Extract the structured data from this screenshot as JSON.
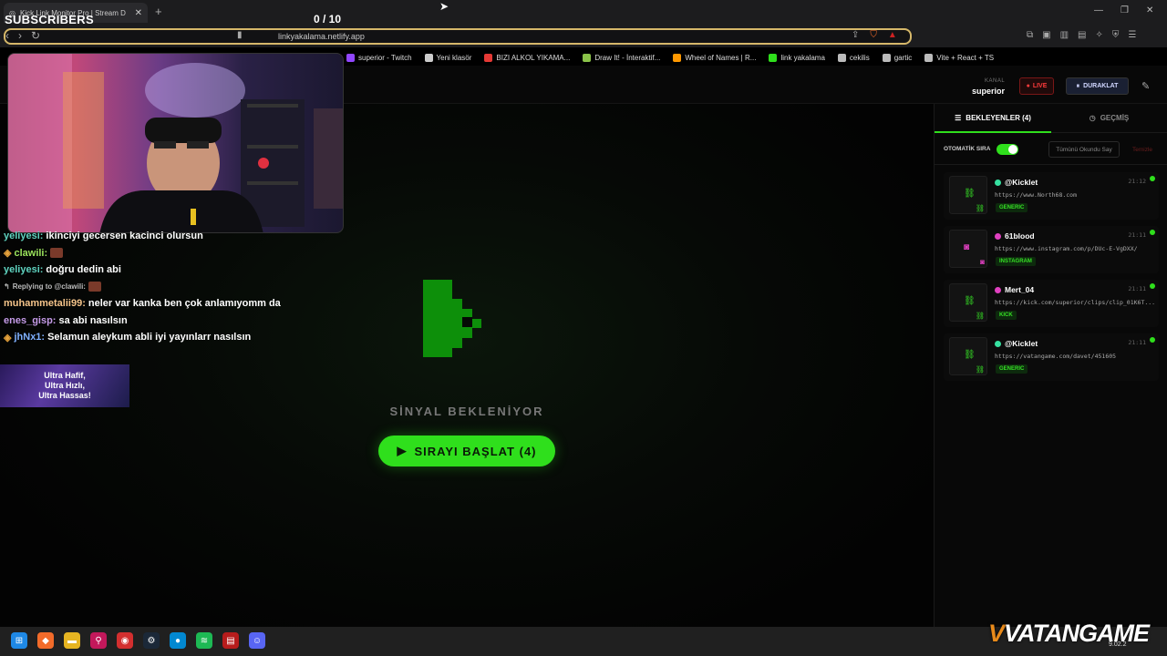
{
  "browser": {
    "tab_title": "Kick Link Monitor Pro | Stream D",
    "url": "linkyakalama.netlify.app",
    "bookmarks": [
      {
        "label": "superior - Twitch",
        "color": "#9146ff"
      },
      {
        "label": "Yeni klasör",
        "color": "#cccccc"
      },
      {
        "label": "BIZI ALKOL YIKAMA...",
        "color": "#e53935"
      },
      {
        "label": "Draw It! - İnteraktif...",
        "color": "#8bc34a"
      },
      {
        "label": "Wheel of Names | R...",
        "color": "#ff9800"
      },
      {
        "label": "link yakalama",
        "color": "#2fdf1c"
      },
      {
        "label": "cekilis",
        "color": "#bbbbbb"
      },
      {
        "label": "gartic",
        "color": "#bbbbbb"
      },
      {
        "label": "Vite + React + TS",
        "color": "#bbbbbb"
      }
    ]
  },
  "overlay": {
    "subscribers_label": "SUBSCRIBERS",
    "subscribers_count": "0 / 10"
  },
  "header": {
    "channel_label": "KANAL",
    "channel_value": "superior",
    "live_label": "LIVE",
    "pause_label": "DURAKLAT"
  },
  "main": {
    "signal_text": "SİNYAL BEKLENİYOR",
    "start_button": "SIRAYI BAŞLAT (4)"
  },
  "sidebar": {
    "tab_waiting": "BEKLEYENLER (4)",
    "tab_history": "GEÇMİŞ",
    "auto_queue_label": "OTOMATİK SIRA",
    "auto_queue_on": true,
    "mark_all_read": "Tümünü Okundu Say",
    "clear": "Temizle",
    "items": [
      {
        "user": "@Kicklet",
        "time": "21:12",
        "url": "https://www.North68.com",
        "tag": "GENERIC",
        "dot_color": "#36e0a0"
      },
      {
        "user": "61blood",
        "time": "21:11",
        "url": "https://www.instagram.com/p/DUc-E-VgDXX/",
        "tag": "INSTAGRAM",
        "dot_color": "#e040c0"
      },
      {
        "user": "Mert_04",
        "time": "21:11",
        "url": "https://kick.com/superior/clips/clip_01K6T...",
        "tag": "KICK",
        "dot_color": "#e040c0"
      },
      {
        "user": "@Kicklet",
        "time": "21:11",
        "url": "https://vatangame.com/davet/451605",
        "tag": "GENERIC",
        "dot_color": "#36e0a0"
      }
    ]
  },
  "chat": {
    "messages": [
      {
        "name": "yeliyesi:",
        "name_color": "#5fd3c0",
        "text": "ikinciyi gecersen kacinci olursun"
      },
      {
        "name": "clawili:",
        "name_color": "#9be35c",
        "text": ""
      },
      {
        "name": "yeliyesi:",
        "name_color": "#5fd3c0",
        "text": "doğru dedin abi"
      },
      {
        "name": "Replying to @clawili:",
        "name_color": "#bbbbbb",
        "text": "",
        "reply": true
      },
      {
        "name": "muhammetalii99:",
        "name_color": "#f5c48a",
        "text": "neler var kanka ben çok anlamıyomm da"
      },
      {
        "name": "enes_gisp:",
        "name_color": "#c59be8",
        "text": "sa abi nasılsın"
      },
      {
        "name": "jhNx1:",
        "name_color": "#7fb0ff",
        "text": "Selamun aleykum abli iyi yayınlarr nasılsın"
      }
    ],
    "ad_lines": [
      "Ultra Hafif,",
      "Ultra Hızlı,",
      "Ultra Hassas!"
    ]
  },
  "watermark": "VATANGAME",
  "tray_time": "9.02.2"
}
